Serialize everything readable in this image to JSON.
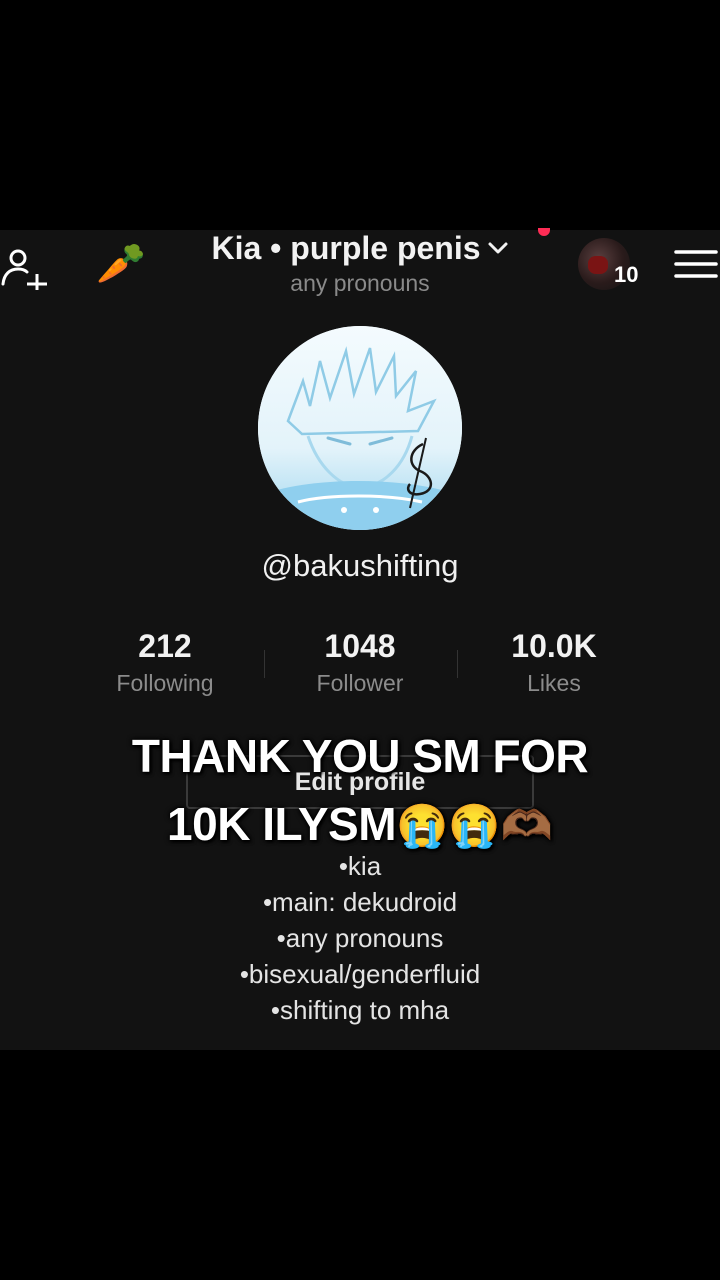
{
  "header": {
    "title": "Kia • purple penis",
    "subtitle": "any pronouns",
    "carrot_icon": "🥕",
    "story_count": "10",
    "accent_color": "#fe2c55"
  },
  "profile": {
    "handle": "@bakushifting",
    "stats": [
      {
        "value": "212",
        "label": "Following"
      },
      {
        "value": "1048",
        "label": "Follower"
      },
      {
        "value": "10.0K",
        "label": "Likes"
      }
    ],
    "edit_label": "Edit profile",
    "bio": [
      "•kia",
      "•main: dekudroid",
      "•any pronouns",
      "•bisexual/genderfluid",
      "•shifting to mha"
    ]
  },
  "caption": {
    "line1": "THANK YOU SM FOR",
    "line2": "10K ILYSM",
    "emojis": "😭😭🫶🏾"
  }
}
